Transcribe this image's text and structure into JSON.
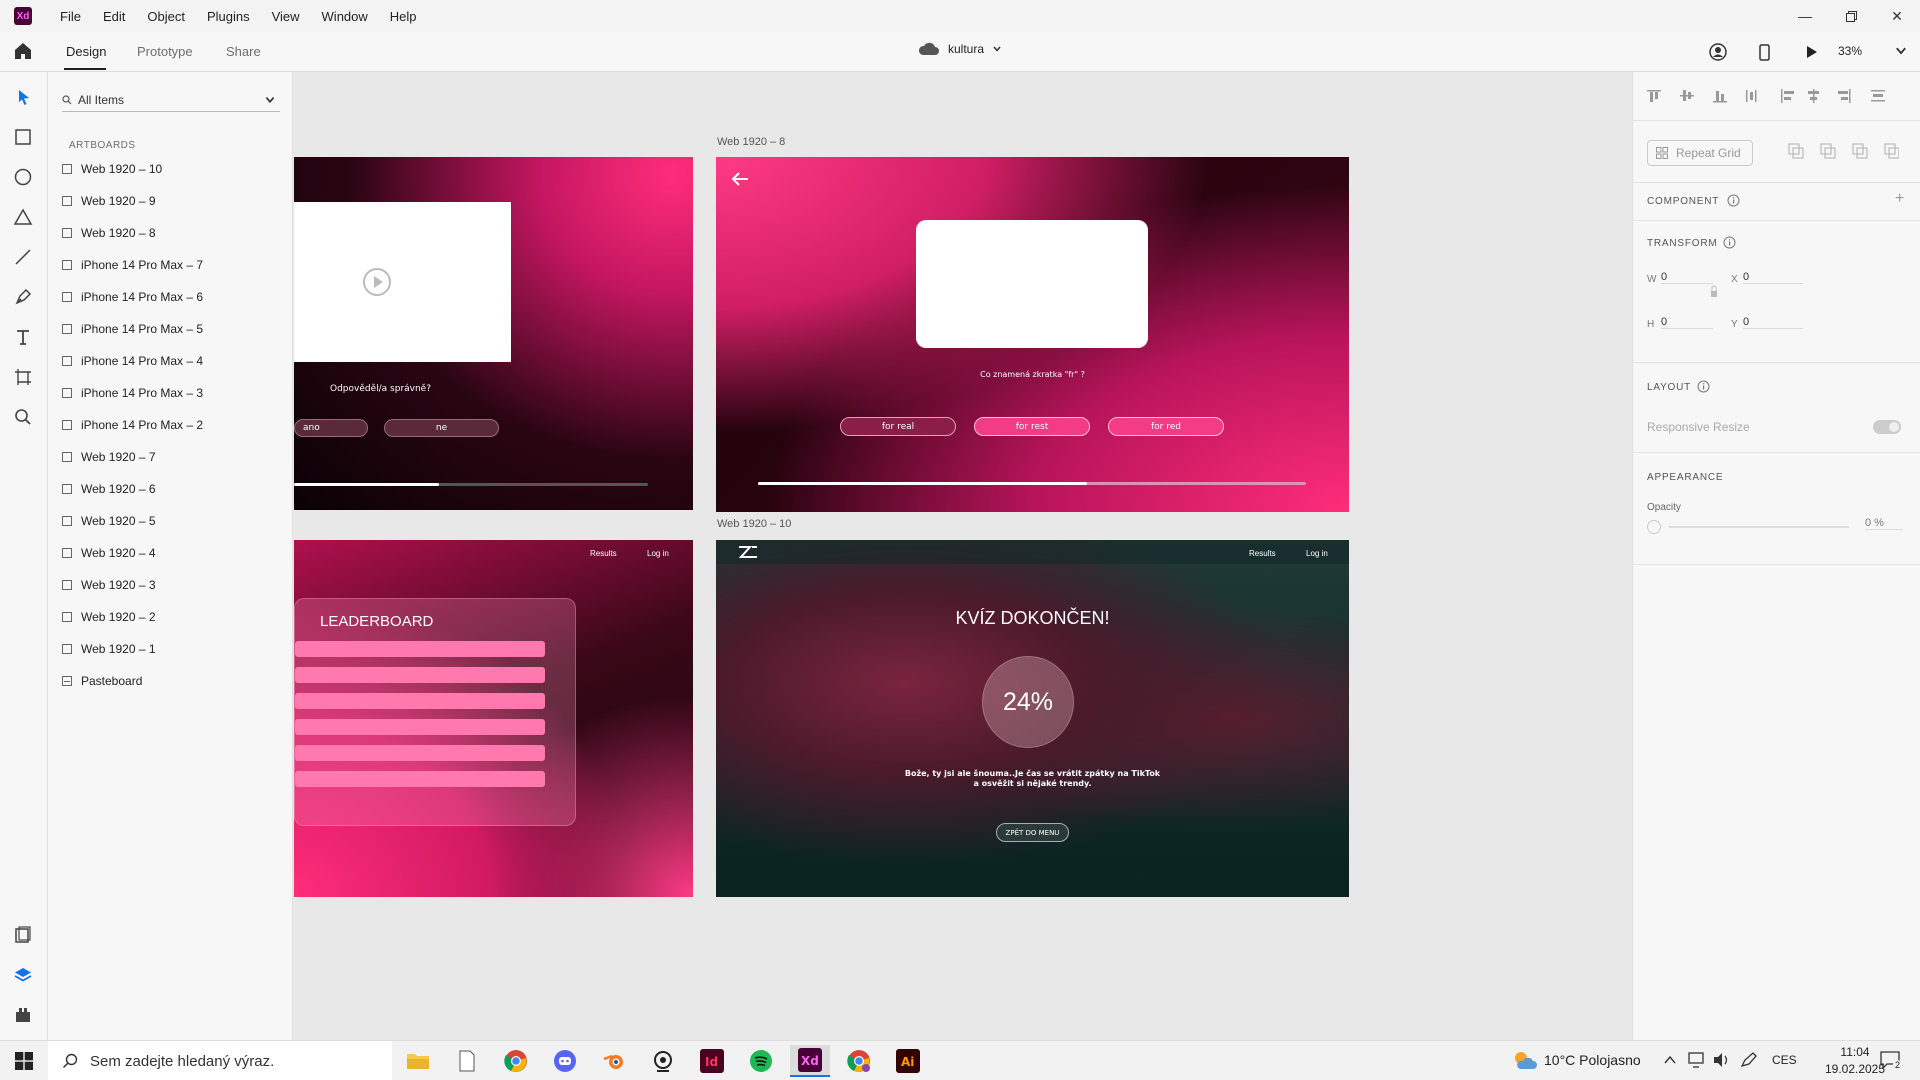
{
  "app": {
    "logo_text": "Xd",
    "menu": [
      "File",
      "Edit",
      "Object",
      "Plugins",
      "View",
      "Window",
      "Help"
    ]
  },
  "toolbar": {
    "tabs": [
      "Design",
      "Prototype",
      "Share"
    ],
    "document_title": "kultura",
    "zoom": "33%"
  },
  "layers": {
    "search_label": "All Items",
    "section_label": "ARTBOARDS",
    "items": [
      "Web 1920 – 10",
      "Web 1920 – 9",
      "Web 1920 – 8",
      "iPhone 14 Pro Max – 7",
      "iPhone 14 Pro Max – 6",
      "iPhone 14 Pro Max – 5",
      "iPhone 14 Pro Max – 4",
      "iPhone 14 Pro Max – 3",
      "iPhone 14 Pro Max – 2",
      "Web 1920 – 7",
      "Web 1920 – 6",
      "Web 1920 – 5",
      "Web 1920 – 4",
      "Web 1920 – 3",
      "Web 1920 – 2",
      "Web 1920 – 1"
    ],
    "pasteboard": "Pasteboard"
  },
  "canvas": {
    "ab8_name": "Web 1920 – 8",
    "ab10_name": "Web 1920 – 10",
    "ab9": {
      "question": "Odpověděl/a správně?",
      "yes": "ano",
      "no": "ne"
    },
    "ab8": {
      "question": "Co znamená zkratka \"fr\" ?",
      "options": [
        "for real",
        "for rest",
        "for red"
      ],
      "progress": 0.6
    },
    "leaderboard": {
      "title": "LEADERBOARD",
      "nav_results": "Results",
      "nav_login": "Log in"
    },
    "ab10": {
      "title": "KVÍZ DOKONČEN!",
      "score": "24%",
      "message_line1": "Bože, ty jsi ale šnouma..Je čas se vrátit zpátky na TikTok",
      "message_line2": "a osvěžit si nějaké trendy.",
      "back_button": "ZPĚT DO MENU",
      "nav_results": "Results",
      "nav_login": "Log in"
    }
  },
  "properties": {
    "repeat_grid": "Repeat Grid",
    "component": "COMPONENT",
    "transform": "TRANSFORM",
    "w_label": "W",
    "w_value": "0",
    "h_label": "H",
    "h_value": "0",
    "x_label": "X",
    "x_value": "0",
    "y_label": "Y",
    "y_value": "0",
    "layout": "LAYOUT",
    "responsive_resize": "Responsive Resize",
    "appearance": "APPEARANCE",
    "opacity_label": "Opacity",
    "opacity_value": "0 %"
  },
  "taskbar": {
    "search_placeholder": "Sem zadejte hledaný výraz.",
    "weather": "10°C  Polojasno",
    "language": "CES",
    "time": "11:04",
    "date": "19.02.2025",
    "notification_count": "2"
  },
  "colors": {
    "accent": "#1473e6",
    "pink": "#ff2d7a",
    "xd_brand": "#470137"
  }
}
